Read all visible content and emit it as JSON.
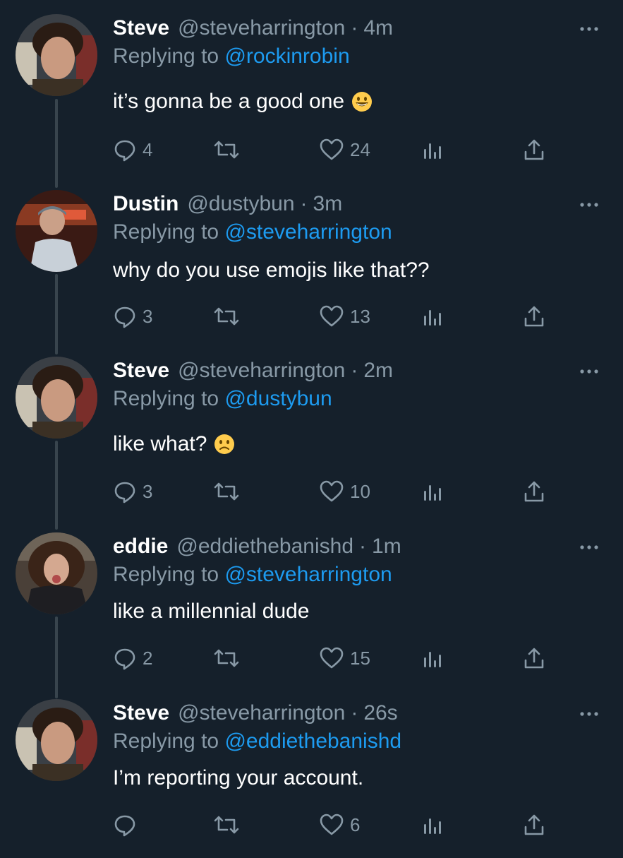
{
  "tweets": [
    {
      "name": "Steve",
      "handle": "@steveharrington",
      "time": "4m",
      "reply_prefix": "Replying to",
      "reply_to": "@rockinrobin",
      "text": "it’s gonna be a good one",
      "emoji": "grinning-face-icon",
      "replies": "4",
      "retweets": "",
      "likes": "24"
    },
    {
      "name": "Dustin",
      "handle": "@dustybun",
      "time": "3m",
      "reply_prefix": "Replying to",
      "reply_to": "@steveharrington",
      "text": "why do you use emojis like that??",
      "emoji": "",
      "replies": "3",
      "retweets": "",
      "likes": "13"
    },
    {
      "name": "Steve",
      "handle": "@steveharrington",
      "time": "2m",
      "reply_prefix": "Replying to",
      "reply_to": "@dustybun",
      "text": "like what?",
      "emoji": "slightly-frowning-face-icon",
      "replies": "3",
      "retweets": "",
      "likes": "10"
    },
    {
      "name": "eddie",
      "handle": "@eddiethebanishd",
      "time": "1m",
      "reply_prefix": "Replying to",
      "reply_to": "@steveharrington",
      "text": "like a millennial dude",
      "emoji": "",
      "replies": "2",
      "retweets": "",
      "likes": "15"
    },
    {
      "name": "Steve",
      "handle": "@steveharrington",
      "time": "26s",
      "reply_prefix": "Replying to",
      "reply_to": "@eddiethebanishd",
      "text": "I’m reporting your account.",
      "emoji": "",
      "replies": "",
      "retweets": "",
      "likes": "6"
    }
  ],
  "separator": "·",
  "colors": {
    "background": "#15202b",
    "secondary_text": "#8899a6",
    "link": "#1d9bf0",
    "thread_line": "#38444d"
  }
}
